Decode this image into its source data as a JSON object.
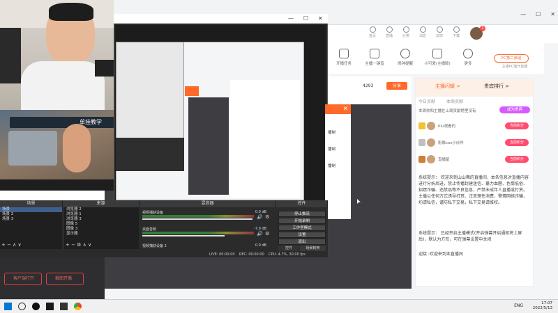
{
  "browser": {
    "minimize": "—",
    "maximize": "☐",
    "close": "✕"
  },
  "site_header": {
    "icons": [
      {
        "label": "首页"
      },
      {
        "label": "直播"
      },
      {
        "label": "分类"
      },
      {
        "label": "消息"
      },
      {
        "label": "动态"
      },
      {
        "label": "下载"
      }
    ],
    "notif_count": "1"
  },
  "features": [
    {
      "label": "开播任务"
    },
    {
      "label": "主播一键直"
    },
    {
      "label": "闹钟提醒"
    },
    {
      "label": "小可爱(主播版)"
    },
    {
      "label": "更多"
    }
  ],
  "pc_button": {
    "label": "PC第二频道",
    "sub": "主播PC端开直播"
  },
  "room_bar": {
    "heat": "4293",
    "share": "分享"
  },
  "chat": {
    "tabs": [
      "主播闪耀 >",
      "贵宾排行 >"
    ],
    "subtabs": [
      "今日贡献",
      "本周贡献"
    ],
    "notice": "本周你和主播在上周贡献榜里没有",
    "join_btn": "成为贵宾",
    "ranks": [
      {
        "name": "Kiu观看的",
        "btn": "当前积分"
      },
      {
        "name": "影像cos小伙伴",
        "btn": "当前积分"
      },
      {
        "name": "直播星",
        "btn": "当前积分"
      }
    ],
    "messages": [
      "系统提示： 欢迎来到山山舞的直播间，本条信息对直播内容进行分析后进，禁止传播封建迷信、暴力血腥、色情低俗、招嫖诈骗、违禁品等不良信息，严禁未成年人直播或打赏。主播以任何方式诱导打赏、注意理性消费，警惕网络诈骗，均请私信，谨防私下交易，私下交易请维权。",
      "系统提示： 已经开启主播模式(开启弹幕开启通知将上屏后)，默认为方形，可在弹幕设置中关闭",
      "迎接 :欢迎来到本直播间"
    ]
  },
  "handcam": {
    "banner": "单挂教学"
  },
  "popup": {
    "close": "✕",
    "lines": [
      "播制",
      "播制",
      "播制"
    ]
  },
  "obs": {
    "close": "✕",
    "max": "☐",
    "min": "—",
    "docks": {
      "scenes": {
        "title": "场景",
        "rows": [
          "场景",
          "场景 2",
          "场景 3"
        ]
      },
      "sources": {
        "title": "来源",
        "rows": [
          "浏览器 2",
          "浏览器 1",
          "浏览器 3",
          "图像 5",
          "图像 3",
          "显示器"
        ]
      },
      "mixer": {
        "title": "混音器",
        "tracks": [
          {
            "name": "视频捕获设备",
            "db": "0.0 dB"
          },
          {
            "name": "桌面音频",
            "db": "-7.0 dB"
          },
          {
            "name": "视频捕获设备 2",
            "db": "0.0 dB"
          }
        ]
      },
      "controls": {
        "title": "控件",
        "buttons": [
          "停止推流",
          "开始录制",
          "工作室模式",
          "设置",
          "退出"
        ],
        "tabs": [
          "控件",
          "场景转换"
        ]
      }
    },
    "status": "LIVE: 00:00:00    REC: 00:00:00    CPU: 4.7%, 30.00 fps"
  },
  "bottom_left": {
    "btn1": "客户端打开",
    "btn2": "截图开播"
  },
  "taskbar": {
    "lang": "ENG",
    "time": "17:07",
    "date": "2022/5/13"
  },
  "colors": {
    "accent": "#ff6a2b",
    "pink": "#ff4d6d",
    "obs_bg": "#2b2b2b"
  }
}
